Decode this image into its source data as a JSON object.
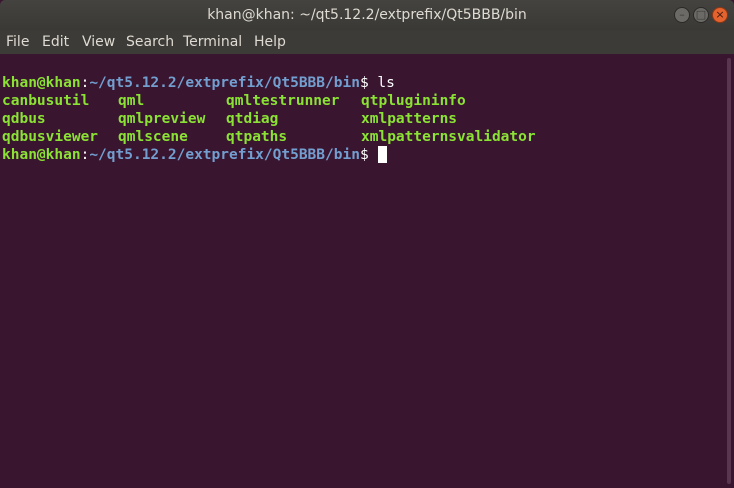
{
  "window": {
    "title": "khan@khan: ~/qt5.12.2/extprefix/Qt5BBB/bin",
    "buttons": {
      "minimize": "–",
      "maximize": "□",
      "close": "×"
    }
  },
  "menu": {
    "file": "File",
    "edit": "Edit",
    "view": "View",
    "search": "Search",
    "terminal": "Terminal",
    "help": "Help"
  },
  "terminal": {
    "prompt": {
      "user": "khan@khan",
      "colon": ":",
      "path": "~/qt5.12.2/extprefix/Qt5BBB/bin",
      "dollar": "$"
    },
    "command": " ls",
    "output_rows": [
      [
        "canbusutil",
        "qml",
        "qmltestrunner",
        "qtplugininfo"
      ],
      [
        "qdbus",
        "qmlpreview",
        "qtdiag",
        "xmlpatterns"
      ],
      [
        "qdbusviewer",
        "qmlscene",
        "qtpaths",
        "xmlpatternsvalidator"
      ]
    ]
  },
  "colors": {
    "background": "#3a1530",
    "prompt_user": "#8ae234",
    "prompt_path": "#729fcf",
    "executable": "#8ae234",
    "titlebar": "#3c3b37",
    "close_button": "#e4622e"
  }
}
